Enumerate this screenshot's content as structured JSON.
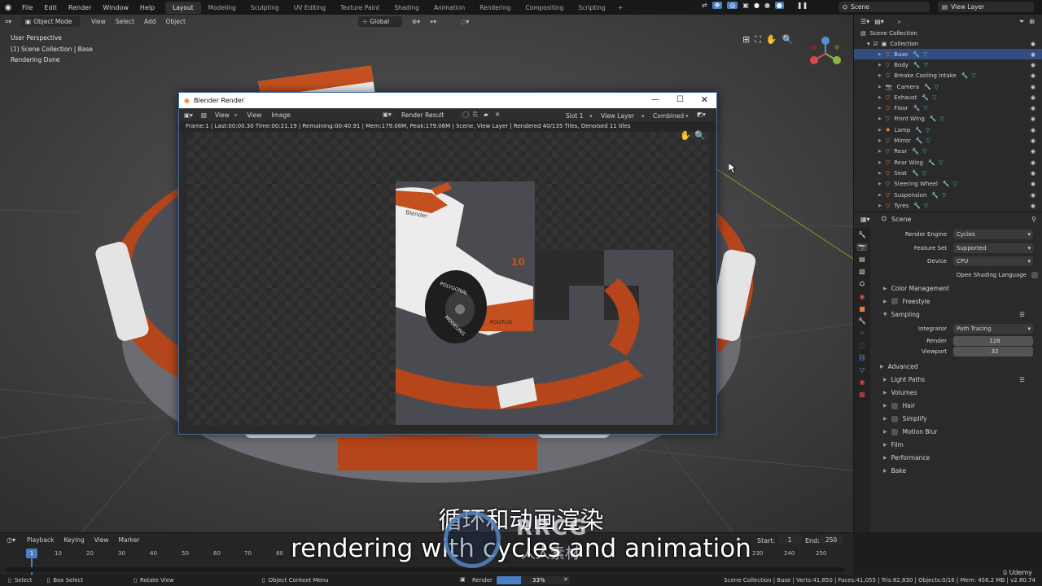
{
  "topbar": {
    "menus": [
      "File",
      "Edit",
      "Render",
      "Window",
      "Help"
    ],
    "workspace_tabs": [
      "Layout",
      "Modeling",
      "Sculpting",
      "UV Editing",
      "Texture Paint",
      "Shading",
      "Animation",
      "Rendering",
      "Compositing",
      "Scripting"
    ],
    "active_tab": "Layout",
    "add_tab": "+",
    "scene": "Scene",
    "view_layer": "View Layer"
  },
  "viewport": {
    "mode": "Object Mode",
    "menus": [
      "View",
      "Select",
      "Add",
      "Object"
    ],
    "transform_orientation": "Global",
    "hud_lines": [
      "User Perspective",
      "(1) Scene Collection | Base",
      "Rendering Done"
    ]
  },
  "render_window": {
    "title": "Blender Render",
    "menus": [
      "View",
      "View",
      "Image"
    ],
    "image_name": "Render Result",
    "slot": "Slot 1",
    "view_layer": "View Layer",
    "pass": "Combined",
    "status": "Frame:1 | Last:00:00.30 Time:00:21.19 | Remaining:00:40.91 | Mem:179.06M, Peak:179.06M | Scene, View Layer | Rendered 40/135 Tiles, Denoised 11 tiles",
    "logo_text": "Blender",
    "brand_text": "POLYFLIX",
    "number_text": "10",
    "tire_text_1": "POLYGONAL",
    "tire_text_2": "MODELING"
  },
  "outliner": {
    "root": "Scene Collection",
    "collection": "Collection",
    "items": [
      "Base",
      "Body",
      "Breake Cooling Intake",
      "Camera",
      "Exhaust",
      "Floor",
      "Front Wing",
      "Lamp",
      "Mirror",
      "Rear",
      "Rear Wing",
      "Seat",
      "Steering Wheel",
      "Suspension",
      "Tyres"
    ],
    "selected": "Base"
  },
  "properties": {
    "scene_label": "Scene",
    "render_engine": {
      "label": "Render Engine",
      "value": "Cycles"
    },
    "feature_set": {
      "label": "Feature Set",
      "value": "Supported"
    },
    "device": {
      "label": "Device",
      "value": "CPU"
    },
    "osl": "Open Shading Language",
    "panels_top": [
      "Color Management",
      "Freestyle",
      "Sampling"
    ],
    "integrator": {
      "label": "Integrator",
      "value": "Path Tracing"
    },
    "render_samples": {
      "label": "Render",
      "value": "128"
    },
    "viewport_samples": {
      "label": "Viewport",
      "value": "32"
    },
    "advanced": "Advanced",
    "panels_bottom": [
      "Light Paths",
      "Volumes",
      "Hair",
      "Simplify",
      "Motion Blur",
      "Film",
      "Performance",
      "Bake"
    ]
  },
  "timeline": {
    "menus": [
      "Playback",
      "Keying",
      "View",
      "Marker"
    ],
    "current_frame": "1",
    "start_label": "Start:",
    "start": "1",
    "end_label": "End:",
    "end": "250",
    "ticks": [
      "10",
      "20",
      "30",
      "40",
      "50",
      "60",
      "70",
      "80",
      "230",
      "240",
      "250"
    ]
  },
  "statusbar": {
    "select": "Select",
    "box_select": "Box Select",
    "rotate_view": "Rotate View",
    "context_menu": "Object Context Menu",
    "render_label": "Render",
    "render_progress": "33%",
    "render_progress_value": 0.33,
    "stats": "Scene Collection | Base | Verts:41,850 | Faces:41,055 | Tris:82,830 | Objects:0/16 | Mem: 456.2 MB | v2.80.74"
  },
  "subtitles": {
    "chinese": "循环和动画渲染",
    "english": "rendering with cycles and animation"
  },
  "watermark": {
    "rrcg": "RRCG",
    "cn": "人人素材",
    "udemy": "Udemy"
  },
  "colors": {
    "accent": "#4a7fc1",
    "selection": "#334d80",
    "orange": "#c4501f",
    "bg": "#3a3a3a"
  }
}
